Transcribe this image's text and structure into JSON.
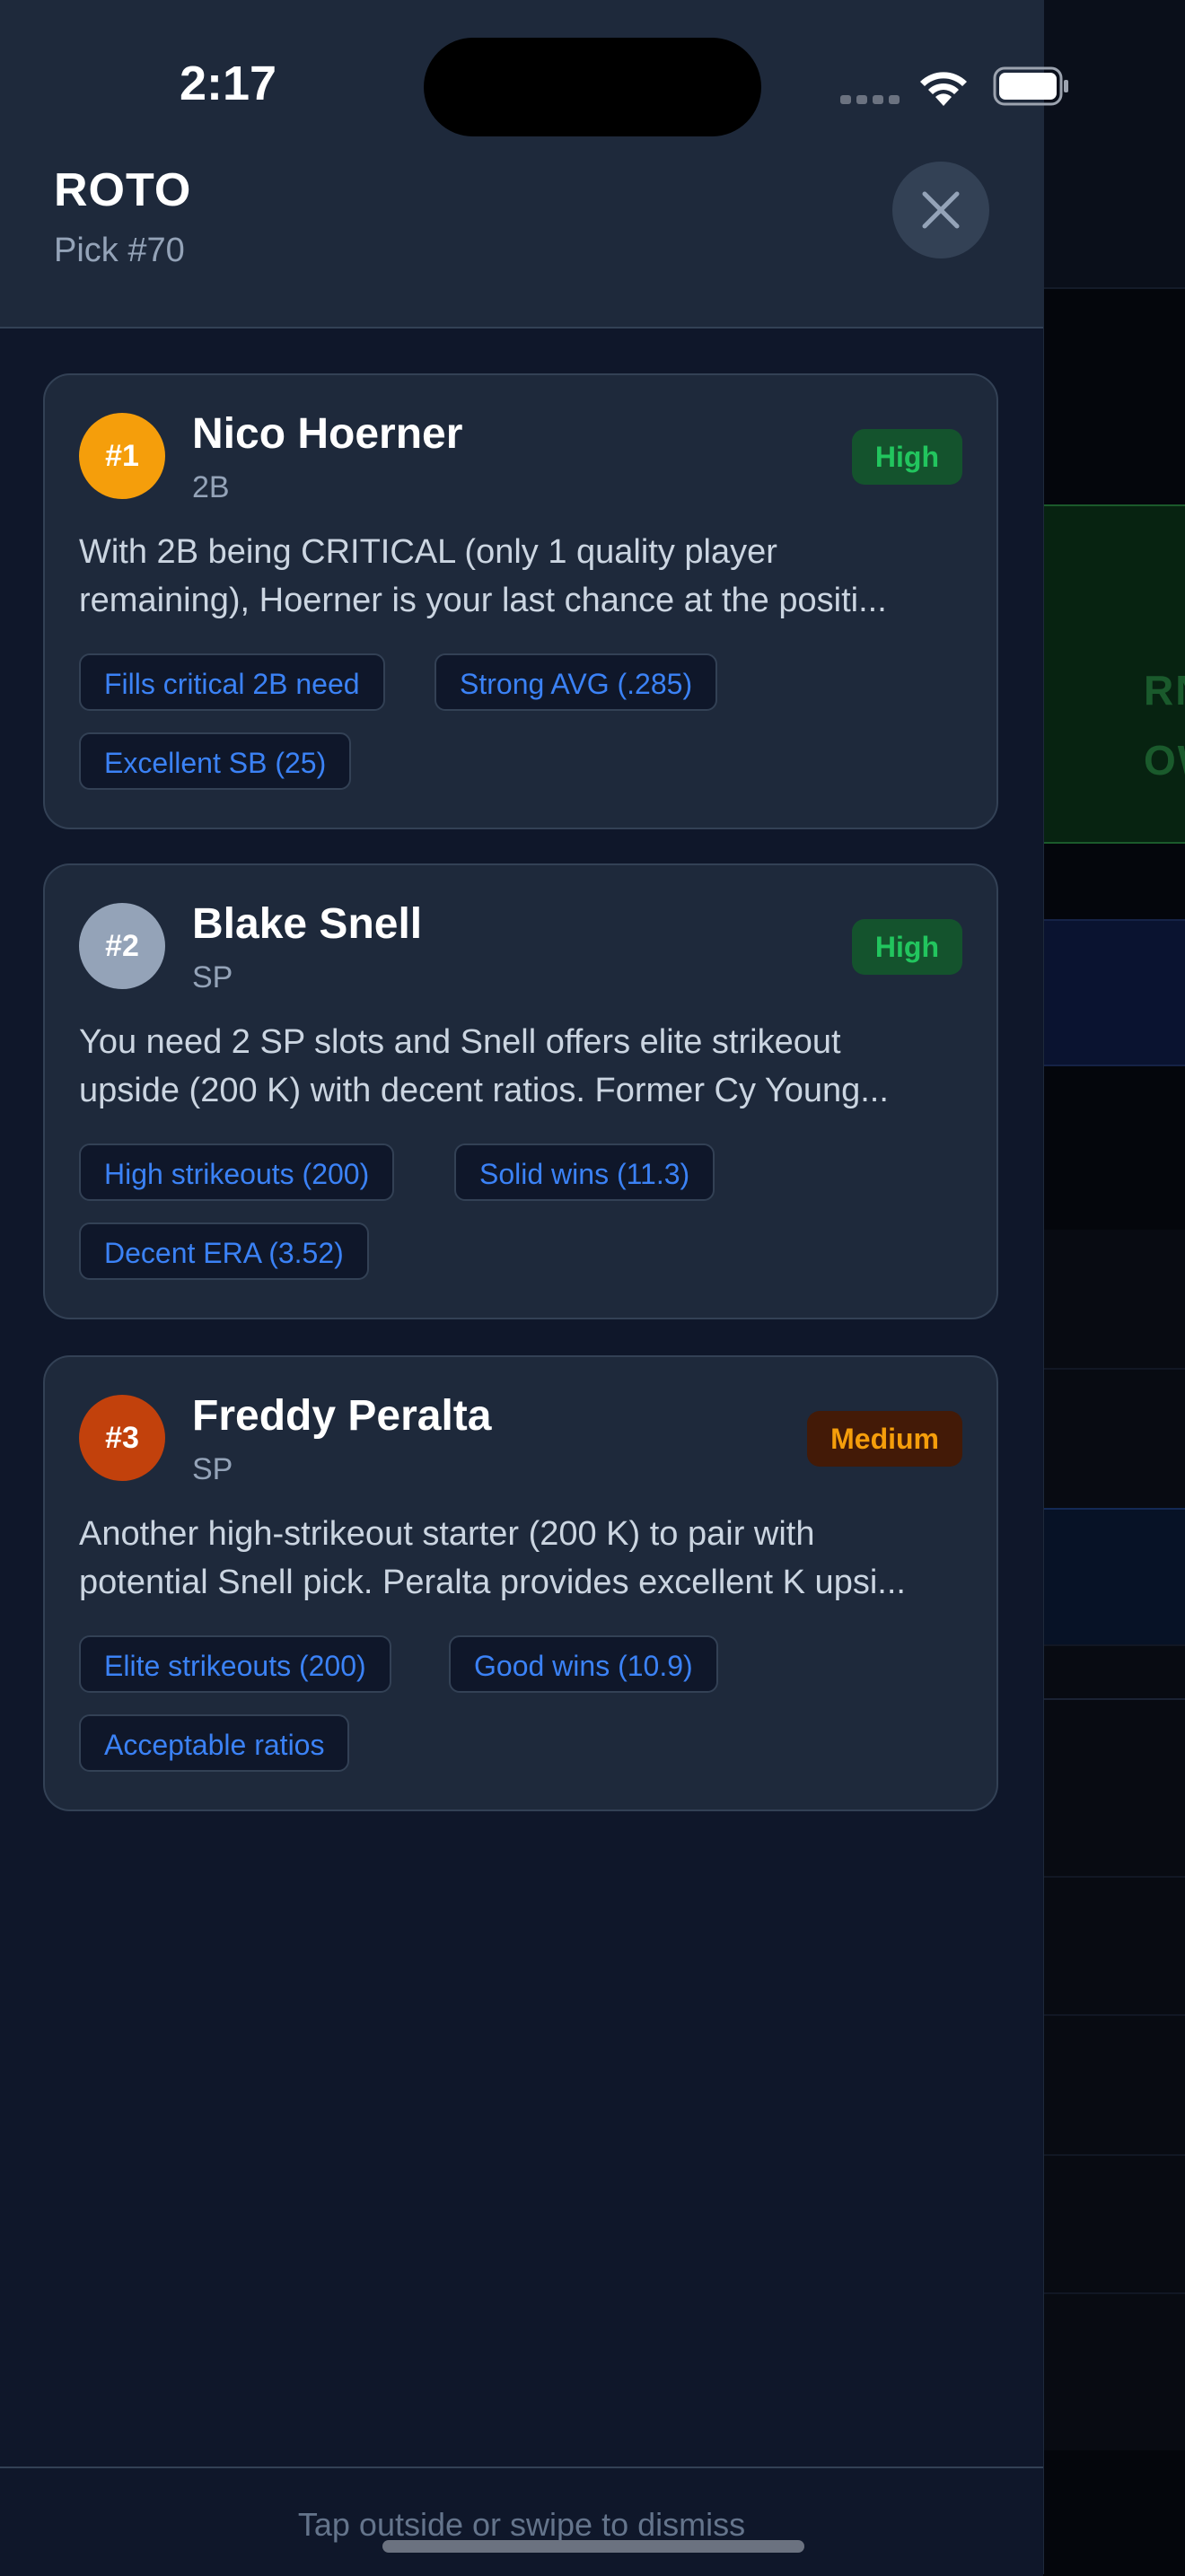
{
  "status_bar": {
    "time": "2:17"
  },
  "header": {
    "title": "ROTO",
    "subtitle": "Pick #70",
    "close_icon": "close-icon"
  },
  "background_app": {
    "banner_line1": "RN!",
    "banner_line2": "OW"
  },
  "recommendations": [
    {
      "rank": "#1",
      "rank_color": "#f59e0b",
      "name": "Nico Hoerner",
      "position": "2B",
      "priority": "High",
      "description_line1": "With 2B being CRITICAL (only 1 quality player",
      "description_line2": "remaining), Hoerner is your last chance at the positi...",
      "tags": [
        "Fills critical 2B need",
        "Strong AVG (.285)",
        "Excellent SB (25)"
      ]
    },
    {
      "rank": "#2",
      "rank_color": "#94a3b8",
      "name": "Blake Snell",
      "position": "SP",
      "priority": "High",
      "description_line1": "You need 2 SP slots and Snell offers elite strikeout",
      "description_line2": "upside (200 K) with decent ratios. Former Cy Young...",
      "tags": [
        "High strikeouts (200)",
        "Solid wins (11.3)",
        "Decent ERA (3.52)"
      ]
    },
    {
      "rank": "#3",
      "rank_color": "#c2410c",
      "name": "Freddy Peralta",
      "position": "SP",
      "priority": "Medium",
      "description_line1": "Another high-strikeout starter (200 K) to pair with",
      "description_line2": "potential Snell pick. Peralta provides excellent K upsi...",
      "tags": [
        "Elite strikeouts (200)",
        "Good wins (10.9)",
        "Acceptable ratios"
      ]
    }
  ],
  "footer": {
    "hint": "Tap outside or swipe to dismiss"
  }
}
